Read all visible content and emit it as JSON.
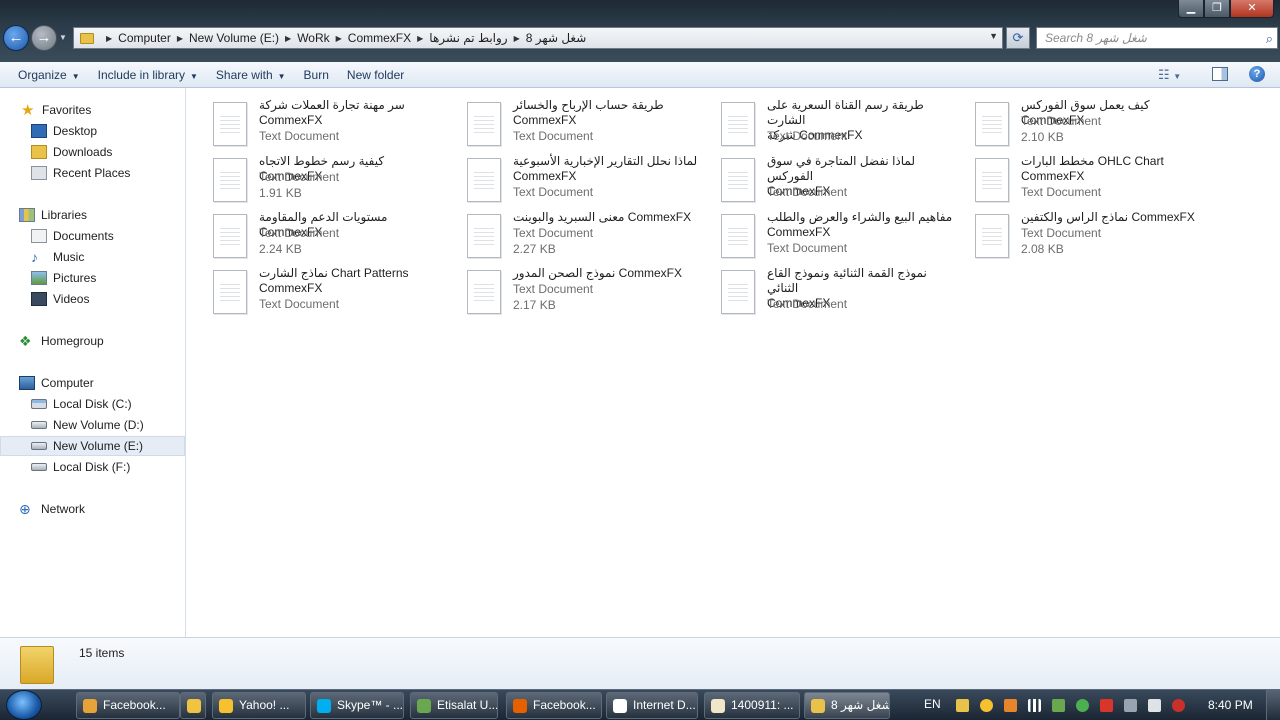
{
  "window": {
    "controls": {
      "minimize": "▁",
      "maximize": "❐",
      "close": "✕"
    }
  },
  "address_bar": {
    "breadcrumbs": [
      "Computer",
      "New Volume (E:)",
      "WoRk",
      "CommexFX",
      "روابط تم نشرها",
      "شغل شهر 8"
    ],
    "search_placeholder": "Search شغل شهر 8",
    "dropdown_glyph": "▼",
    "refresh_glyph": "⟳"
  },
  "toolbar": {
    "organize": "Organize",
    "include_in_library": "Include in library",
    "share_with": "Share with",
    "burn": "Burn",
    "new_folder": "New folder",
    "help_glyph": "?",
    "view_glyph": "☷"
  },
  "nav": {
    "favorites": "Favorites",
    "desktop": "Desktop",
    "downloads": "Downloads",
    "recent_places": "Recent Places",
    "libraries": "Libraries",
    "documents": "Documents",
    "music": "Music",
    "pictures": "Pictures",
    "videos": "Videos",
    "homegroup": "Homegroup",
    "computer": "Computer",
    "local_disk_c": "Local Disk (C:)",
    "new_volume_d": "New Volume (D:)",
    "new_volume_e": "New Volume (E:)",
    "local_disk_f": "Local Disk (F:)",
    "network": "Network"
  },
  "files": [
    {
      "name": "سر مهنة تجارة العملات  شركة\nCommexFX",
      "type": "Text Document",
      "size": ""
    },
    {
      "name": "طريقة حساب الإرباح والخسائر\nCommexFX",
      "type": "Text Document",
      "size": ""
    },
    {
      "name": "طريقة رسم القناة السعرية على الشارت\nشركة CommexFX",
      "type": "Text Document",
      "size": ""
    },
    {
      "name": "كيف يعمل سوق الفوركس  CommexFX",
      "type": "Text Document",
      "size": "2.10 KB"
    },
    {
      "name": "كيفية رسم خطوط الاتجاه  CommexFX",
      "type": "Text Document",
      "size": "1.91 KB"
    },
    {
      "name": "لماذا نحلل التقارير الإخبارية الأسبوعية\nCommexFX",
      "type": "Text Document",
      "size": ""
    },
    {
      "name": "لماذا نفضل المتاجرة في سوق الفوركس\nCommexFX",
      "type": "Text Document",
      "size": ""
    },
    {
      "name": "مخطط البارات OHLC Chart\nCommexFX",
      "type": "Text Document",
      "size": ""
    },
    {
      "name": "مستويات الدعم والمقاومة  CommexFX",
      "type": "Text Document",
      "size": "2.24 KB"
    },
    {
      "name": "معنى السبريد والبوينت  CommexFX",
      "type": "Text Document",
      "size": "2.27 KB"
    },
    {
      "name": "مفاهيم البيع والشراء والعرض والطلب\nCommexFX",
      "type": "Text Document",
      "size": ""
    },
    {
      "name": "نماذج الراس والكتفين   CommexFX",
      "type": "Text Document",
      "size": "2.08 KB"
    },
    {
      "name": "نماذج الشارت Chart Patterns\nCommexFX",
      "type": "Text Document",
      "size": ""
    },
    {
      "name": "نموذج الصحن المدور CommexFX",
      "type": "Text Document",
      "size": "2.17 KB"
    },
    {
      "name": "نموذج القمة الثنائية ونموذج القاع الثنائي\nCommexFX",
      "type": "Text Document",
      "size": ""
    }
  ],
  "details": {
    "item_count": "15 items"
  },
  "taskbar": {
    "items": [
      {
        "label": "Facebook...",
        "color": "#e8a23a"
      },
      {
        "label": "",
        "color": "#f0c340"
      },
      {
        "label": "Yahoo! ...",
        "color": "#f5c12e"
      },
      {
        "label": "Skype™ - ...",
        "color": "#00aff0"
      },
      {
        "label": "Etisalat U...",
        "color": "#6aa84f"
      },
      {
        "label": "Facebook...",
        "color": "#e66000"
      },
      {
        "label": "Internet D...",
        "color": "#ffffff"
      },
      {
        "label": "1400911: ...",
        "color": "#f1e6c8"
      },
      {
        "label": "شغل شهر 8",
        "color": "#e9c24a"
      }
    ],
    "language": "EN",
    "clock": "8:40 PM"
  },
  "colors": {
    "accent": "#1e395b",
    "selection": "#e5ecf5"
  }
}
